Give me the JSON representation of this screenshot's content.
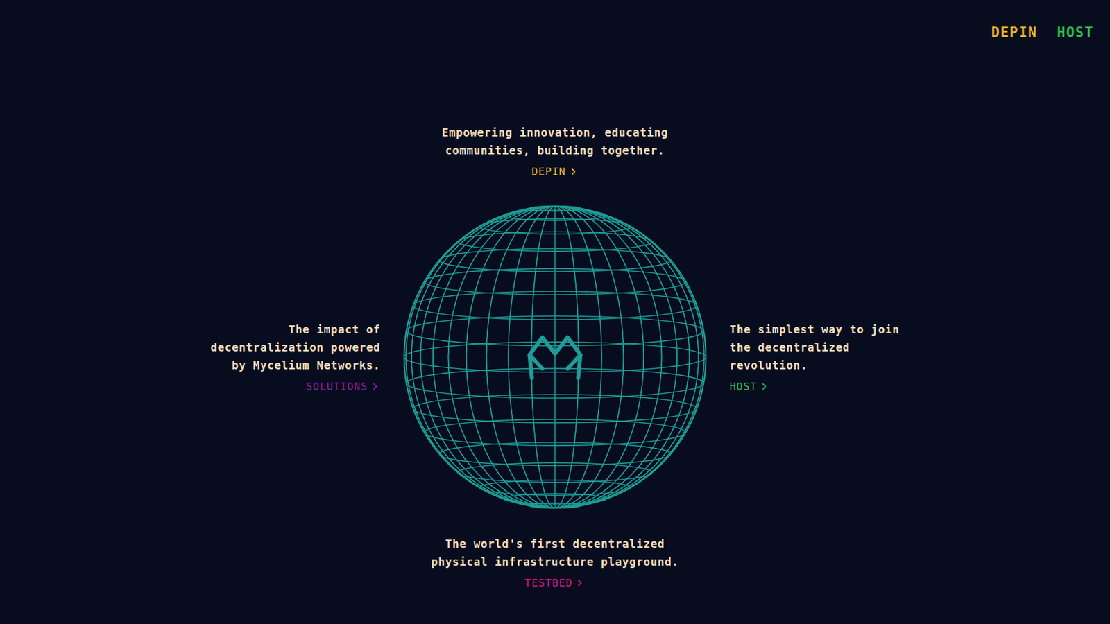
{
  "nav": [
    {
      "label": "DEPIN",
      "color": "#e8b524"
    },
    {
      "label": "HOST",
      "color": "#2bbf4a"
    }
  ],
  "sections": [
    {
      "position": "top",
      "lines": [
        "Empowering innovation, educating",
        "communities, building together."
      ],
      "link": "DEPIN",
      "color": "#e8b524"
    },
    {
      "position": "left",
      "lines": [
        "The impact of",
        "decentralization powered",
        "by Mycelium Networks."
      ],
      "link": "SOLUTIONS",
      "color": "#8c1fa0"
    },
    {
      "position": "right",
      "lines": [
        "The simplest way to join",
        "the decentralized",
        "revolution."
      ],
      "link": "HOST",
      "color": "#2bbf4a"
    },
    {
      "position": "bottom",
      "lines": [
        "The world's first decentralized",
        "physical infrastructure playground."
      ],
      "link": "TESTBED",
      "color": "#e0157c"
    }
  ]
}
